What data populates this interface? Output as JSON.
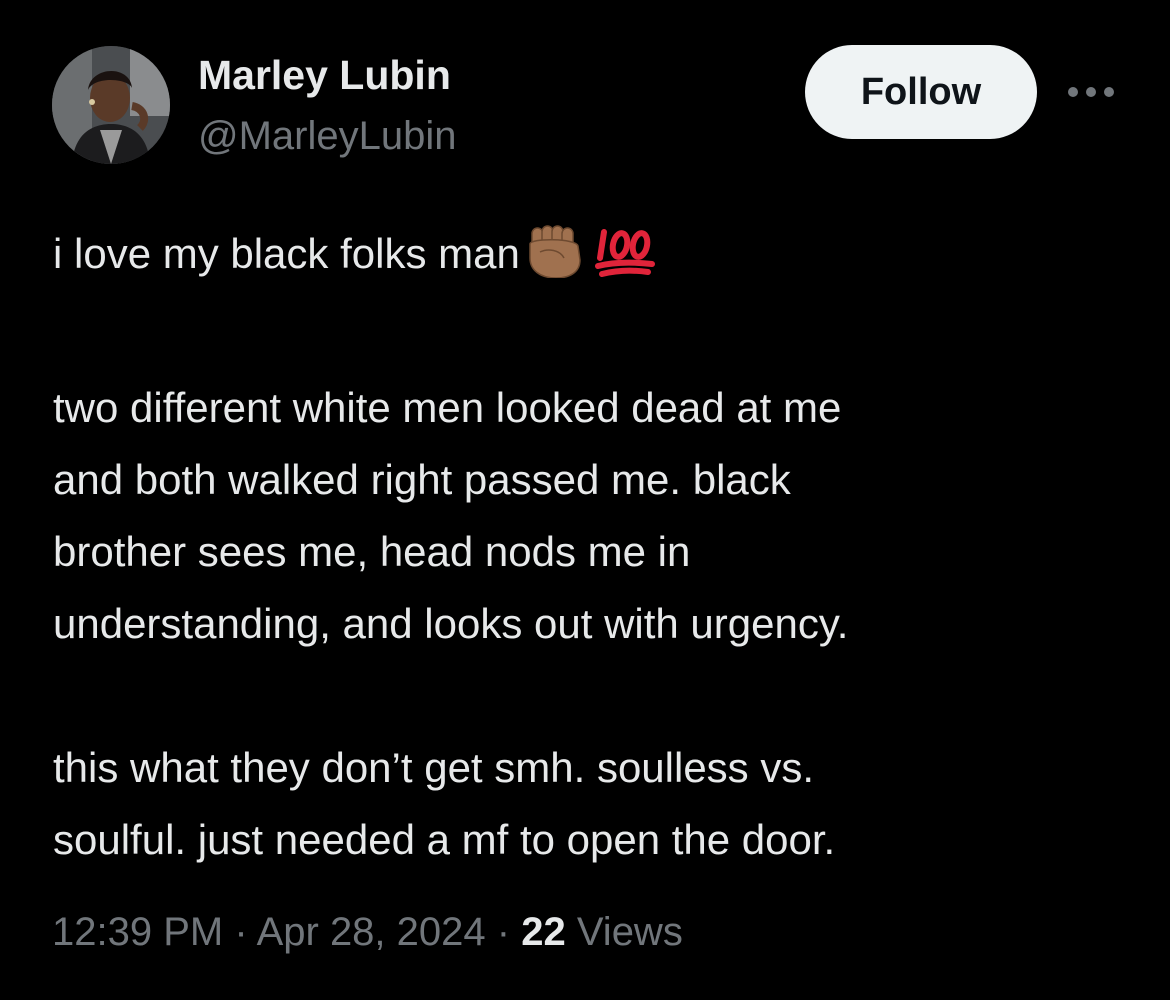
{
  "author": {
    "display_name": "Marley Lubin",
    "handle": "@MarleyLubin"
  },
  "actions": {
    "follow_label": "Follow",
    "more_icon": "ellipsis-icon"
  },
  "tweet": {
    "line1_text": "i love my black folks man",
    "line1_emojis": [
      "raised-fist-medium-dark-skin-emoji",
      "hundred-points-emoji"
    ],
    "paragraph2": [
      "two different white men looked dead at me",
      "and both walked right passed me. black",
      "brother sees me, head nods me in",
      "understanding, and looks out with urgency."
    ],
    "paragraph3": [
      "this what they don’t get smh. soulless vs.",
      "soulful. just needed a mf to open the door."
    ]
  },
  "meta": {
    "time": "12:39 PM",
    "separator": "·",
    "date": "Apr 28, 2024",
    "views_count": "22",
    "views_label": "Views"
  },
  "colors": {
    "background": "#000000",
    "primary_text": "#e7e9ea",
    "secondary_text": "#71767b",
    "follow_bg": "#eff3f4",
    "follow_text": "#0f1419",
    "hundred_red": "#e0243a"
  }
}
